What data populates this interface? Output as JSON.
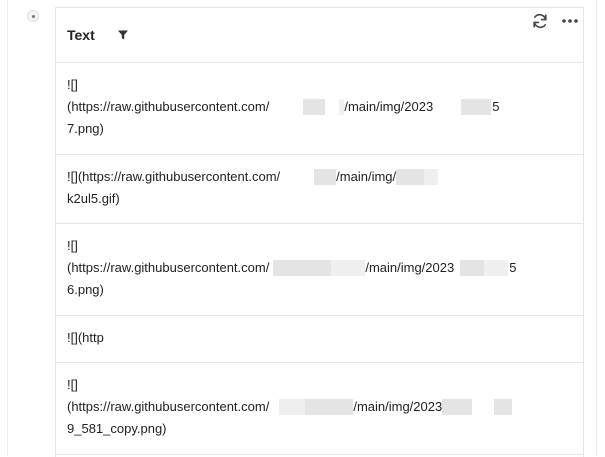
{
  "table": {
    "column_header": "Text",
    "header_icons": [
      "filter-icon",
      "refresh-icon",
      "more-icon"
    ],
    "rows": [
      {
        "lines": [
          [
            "![]"
          ],
          [
            "(https://raw.githubusercontent.com/",
            "/main/img/2023",
            "5"
          ],
          [
            "7.png)"
          ]
        ]
      },
      {
        "lines": [
          [
            "![](https://raw.githubusercontent.com/",
            "/main/img/"
          ],
          [
            "k2ul5.gif)"
          ]
        ]
      },
      {
        "lines": [
          [
            "![]"
          ],
          [
            "(https://raw.githubusercontent.com/",
            "/main/img/2023",
            "5"
          ],
          [
            "6.png)"
          ]
        ]
      },
      {
        "lines": [
          [
            "![](http"
          ]
        ]
      },
      {
        "lines": [
          [
            "![]"
          ],
          [
            "(https://raw.githubusercontent.com/",
            "/main/img/2023"
          ],
          [
            "9_581_copy.png)"
          ]
        ]
      }
    ]
  }
}
